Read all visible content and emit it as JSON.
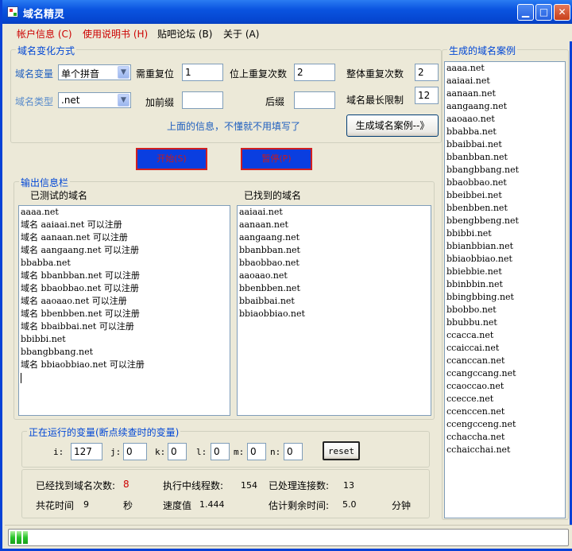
{
  "window": {
    "title": "域名精灵"
  },
  "menu": [
    {
      "label": "帐户信息",
      "key": "(C)",
      "color": "#cc0000"
    },
    {
      "label": "使用说明书",
      "key": "(H)",
      "color": "#cc0000"
    },
    {
      "label": "贴吧论坛",
      "key": "(B)",
      "color": "#000000"
    },
    {
      "label": "关于",
      "key": "(A)",
      "color": "#000000"
    }
  ],
  "variation": {
    "group_title": "域名变化方式",
    "var_label": "域名变量",
    "var_value": "单个拼音",
    "need_reset_label": "需重复位",
    "need_reset_value": "1",
    "pos_repeat_label": "位上重复次数",
    "pos_repeat_value": "2",
    "total_repeat_label": "整体重复次数",
    "total_repeat_value": "2",
    "type_label": "域名类型",
    "type_value": ".net",
    "prefix_label": "加前缀",
    "prefix_value": "",
    "suffix_label": "后缀",
    "suffix_value": "",
    "max_len_label": "域名最长限制",
    "max_len_value": "12",
    "hint": "上面的信息，不懂就不用填写了",
    "generate_button": "生成域名案例--》"
  },
  "actions": {
    "start_button": "开始(S)",
    "pause_button": "暂停(P)"
  },
  "output": {
    "group_title": "输出信息栏",
    "tested_label": "已测试的域名",
    "found_label": "已找到的域名",
    "tested": [
      "aaaa.net",
      "域名 aaiaai.net 可以注册",
      "域名 aanaan.net 可以注册",
      "域名 aangaang.net 可以注册",
      "bbabba.net",
      "域名 bbanbban.net 可以注册",
      "域名 bbaobbao.net 可以注册",
      "域名 aaoaao.net 可以注册",
      "域名 bbenbben.net 可以注册",
      "域名 bbaibbai.net 可以注册",
      "bbibbi.net",
      "bbangbbang.net",
      "域名 bbiaobbiao.net 可以注册"
    ],
    "found": [
      "aaiaai.net",
      "aanaan.net",
      "aangaang.net",
      "bbanbban.net",
      "bbaobbao.net",
      "aaoaao.net",
      "bbenbben.net",
      "bbaibbai.net",
      "bbiaobbiao.net"
    ]
  },
  "running": {
    "group_title": "正在运行的变量(断点续查时的变量)",
    "i_label": "i:",
    "i_value": "127",
    "j_label": "j:",
    "j_value": "0",
    "k_label": "k:",
    "k_value": "0",
    "l_label": "l:",
    "l_value": "0",
    "m_label": "m:",
    "m_value": "0",
    "n_label": "n:",
    "n_value": "0",
    "reset_button": "reset"
  },
  "stats": {
    "found_count_label": "已经找到域名次数:",
    "found_count_value": "8",
    "threads_label": "执行中线程数:",
    "threads_value": "154",
    "processed_label": "已处理连接数:",
    "processed_value": "13",
    "time_label": "共花时间",
    "time_value": "9",
    "time_unit": "秒",
    "speed_label": "速度值",
    "speed_value": "1.444",
    "remaining_label": "估计剩余时间:",
    "remaining_value": "5.0",
    "remaining_unit": "分钟"
  },
  "examples": {
    "group_title": "生成的域名案例",
    "items": [
      "aaaa.net",
      "aaiaai.net",
      "aanaan.net",
      "aangaang.net",
      "aaoaao.net",
      "bbabba.net",
      "bbaibbai.net",
      "bbanbban.net",
      "bbangbbang.net",
      "bbaobbao.net",
      "bbeibbei.net",
      "bbenbben.net",
      "bbengbbeng.net",
      "bbibbi.net",
      "bbianbbian.net",
      "bbiaobbiao.net",
      "bbiebbie.net",
      "bbinbbin.net",
      "bbingbbing.net",
      "bbobbo.net",
      "bbubbu.net",
      "ccacca.net",
      "ccaiccai.net",
      "ccanccan.net",
      "ccangccang.net",
      "ccaoccao.net",
      "ccecce.net",
      "ccenccen.net",
      "ccengcceng.net",
      "cchaccha.net",
      "cchaicchai.net"
    ]
  },
  "progress": {
    "segments": 3
  }
}
